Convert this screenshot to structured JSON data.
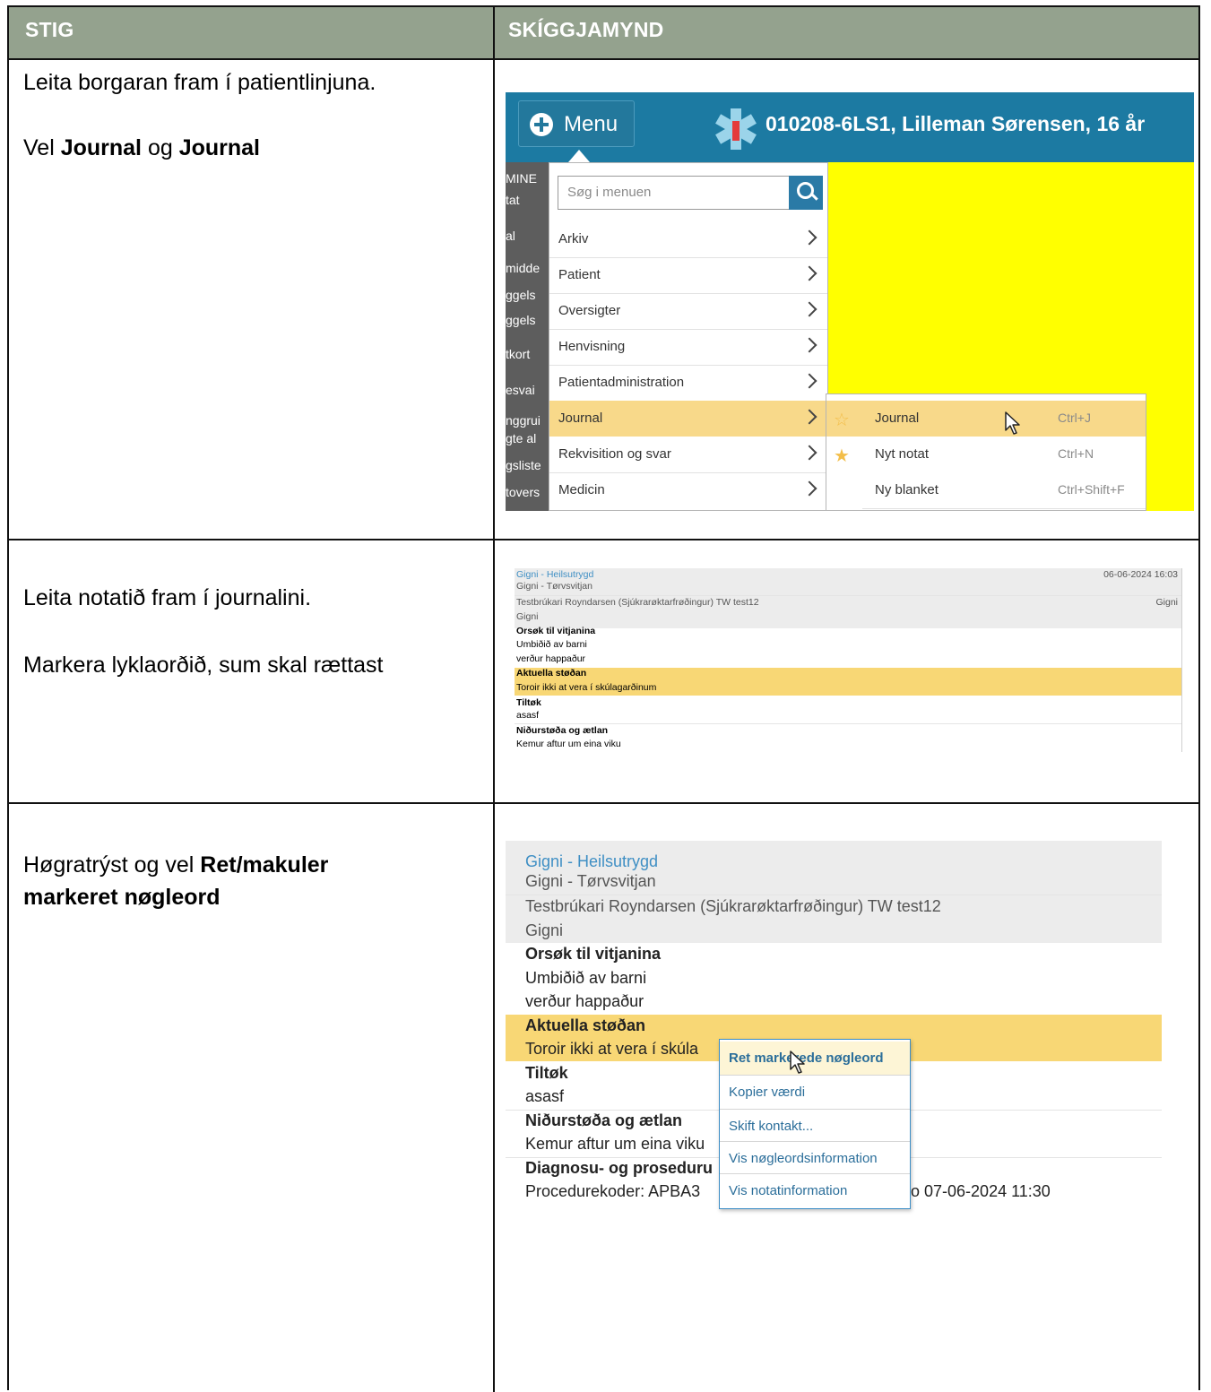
{
  "header": {
    "col1": "STIG",
    "col2": "SKÍGGJAMYND"
  },
  "steps": [
    {
      "line1": "Leita borgaran fram í patientlinjuna.",
      "line2_a": "Vel ",
      "line2_b": "Journal",
      "line2_c": " og ",
      "line2_d": "Journal"
    },
    {
      "line1": "Leita notatið fram í journalini.",
      "line2": "Markera lyklaorðið, sum skal rættast"
    },
    {
      "line1_a": "Høgratrýst og vel ",
      "line1_b": "Ret/makuler",
      "line2": "markeret nøgleord"
    }
  ],
  "shot1": {
    "menu_label": "Menu",
    "patient": "010208-6LS1,  Lilleman Sørensen,  16 år",
    "search_placeholder": "Søg i menuen",
    "left_nav": [
      "MINE",
      "tat",
      "al",
      "midde",
      "ggels",
      "ggels",
      "tkort",
      "esvai",
      "nggrui",
      "gte al",
      "gsliste",
      "tovers"
    ],
    "menu_items": [
      "Arkiv",
      "Patient",
      "Oversigter",
      "Henvisning",
      "Patientadministration",
      "Journal",
      "Rekvisition og svar",
      "Medicin"
    ],
    "submenu": [
      {
        "label": "Journal",
        "shortcut": "Ctrl+J"
      },
      {
        "label": "Nyt notat",
        "shortcut": "Ctrl+N"
      },
      {
        "label": "Ny blanket",
        "shortcut": "Ctrl+Shift+F"
      }
    ],
    "colors": {
      "topbar": "#1c7aa2",
      "background": "#ffff00",
      "highlight": "#f8d98a"
    }
  },
  "shot2": {
    "title": "Gigni - Heilsutrygd",
    "timestamp": "06-06-2024 16:03",
    "subtitle": "Gigni - Tørvsvitjan",
    "author": "Testbrúkari Royndarsen (Sjúkrarøktarfrøðingur) TW test12",
    "author_right": "Gigni",
    "org": "Gigni",
    "h1": "Orsøk til vitjanina",
    "t1a": "Umbiðið av barni",
    "t1b": "verður happaður",
    "h2": "Aktuella støðan",
    "t2": "Toroir ikki at vera í skúlagarðinum",
    "h3": "Tiltøk",
    "t3": "asasf",
    "h4": "Niðurstøða og ætlan",
    "t4": "Kemur aftur um eina viku"
  },
  "shot3": {
    "title": "Gigni - Heilsutrygd",
    "subtitle": "Gigni - Tørvsvitjan",
    "author": "Testbrúkari Royndarsen (Sjúkrarøktarfrøðingur) TW test12",
    "org": "Gigni",
    "h1": "Orsøk til vitjanina",
    "t1a": "Umbiðið av barni",
    "t1b": "verður happaður",
    "h2": "Aktuella støðan",
    "t2": "Toroir ikki at vera í skúla",
    "h3": "Tiltøk",
    "t3": "asasf",
    "h4": "Niðurstøða og ætlan",
    "t4": "Kemur aftur um eina viku",
    "h5": "Diagnosu- og proseduru",
    "t5": "Procedurekoder: APBA3",
    "t5_right": "o 07-06-2024 11:30",
    "context_menu": [
      "Ret markerede nøgleord",
      "Kopier værdi",
      "Skift kontakt...",
      "Vis nøgleordsinformation",
      "Vis notatinformation"
    ]
  }
}
